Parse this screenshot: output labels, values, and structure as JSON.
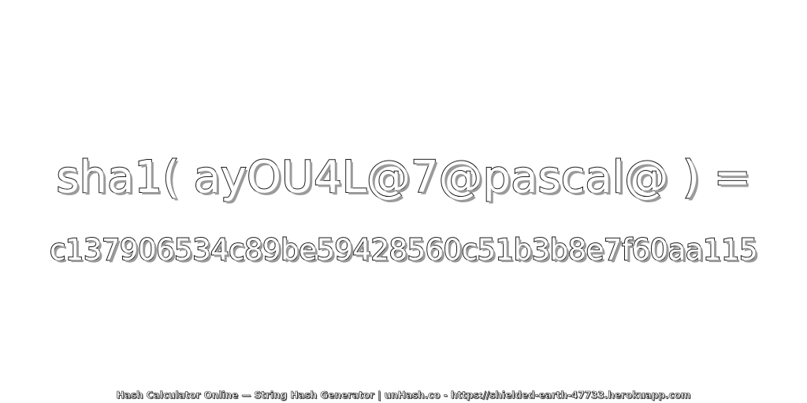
{
  "expression": "sha1( ayOU4L@7@pascal@ ) =",
  "hash_value": "c137906534c89be59428560c51b3b8e7f60aa115",
  "footer": "Hash Calculator Online — String Hash Generator | unHash.co - https://shielded-earth-47733.herokuapp.com",
  "colors": {
    "background": "#ffffff",
    "text_fill": "#ffffff",
    "text_outline": "#1a1a1a",
    "text_shadow": "#9a9a9a"
  }
}
